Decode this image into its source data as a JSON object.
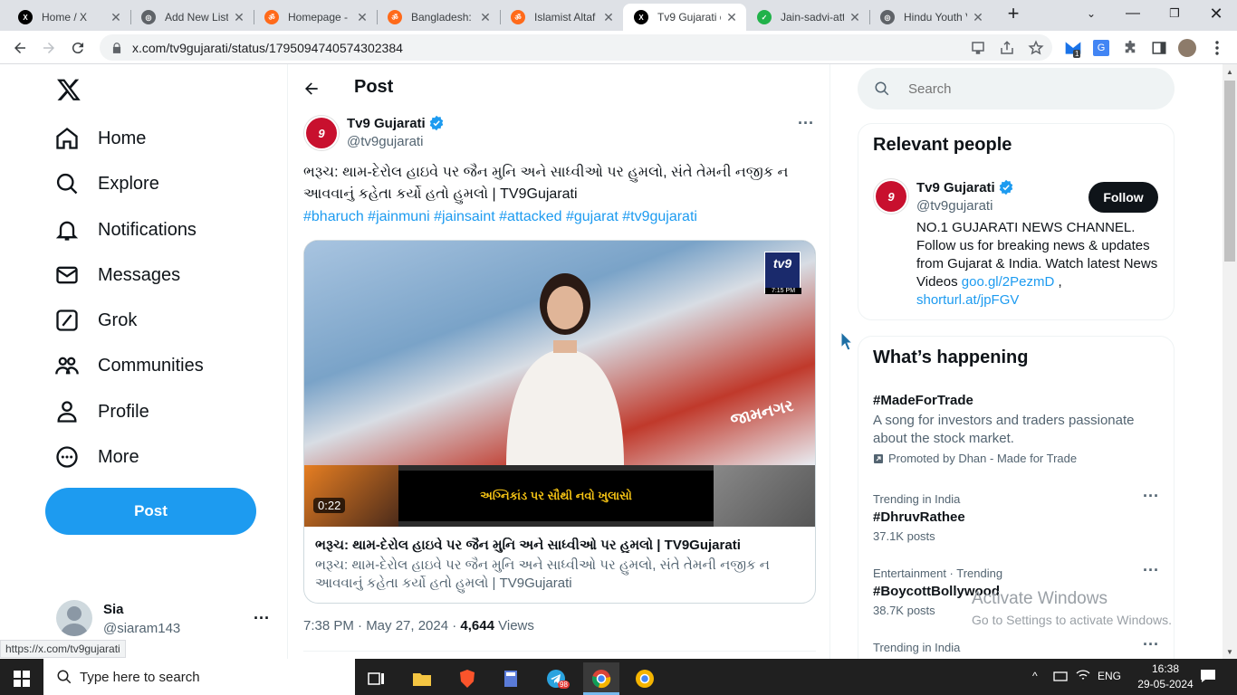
{
  "browser": {
    "tabs": [
      {
        "title": "Home / X",
        "icon": "x-logo-icon",
        "color": "#000000"
      },
      {
        "title": "Add New List",
        "icon": "globe-icon",
        "color": "#5f6368"
      },
      {
        "title": "Homepage - ",
        "icon": "hindutva-icon",
        "color": "#ff6a1a"
      },
      {
        "title": "Bangladesh: I",
        "icon": "hindutva-icon",
        "color": "#ff6a1a"
      },
      {
        "title": "Islamist Altaf",
        "icon": "hindutva-icon",
        "color": "#ff6a1a"
      },
      {
        "title": "Tv9 Gujarati o",
        "icon": "x-logo-icon",
        "color": "#000000"
      },
      {
        "title": "Jain-sadvi-att",
        "icon": "leaf-icon",
        "color": "#21b24a"
      },
      {
        "title": "Hindu Youth V",
        "icon": "globe-icon",
        "color": "#5f6368"
      }
    ],
    "url": "x.com/tv9gujarati/status/1795094740574302384",
    "status_url": "https://x.com/tv9gujarati",
    "ext_badge": "1"
  },
  "sidebar": {
    "items": [
      {
        "label": "Home",
        "icon": "home-icon"
      },
      {
        "label": "Explore",
        "icon": "search-icon"
      },
      {
        "label": "Notifications",
        "icon": "bell-icon"
      },
      {
        "label": "Messages",
        "icon": "mail-icon"
      },
      {
        "label": "Grok",
        "icon": "grok-icon"
      },
      {
        "label": "Communities",
        "icon": "people-icon"
      },
      {
        "label": "Profile",
        "icon": "person-icon"
      },
      {
        "label": "More",
        "icon": "more-circle-icon"
      }
    ],
    "post_label": "Post",
    "account": {
      "name": "Sia",
      "handle": "@siaram143"
    }
  },
  "post": {
    "header": "Post",
    "author_name": "Tv9 Gujarati",
    "author_handle": "@tv9gujarati",
    "text": "ભરૂચ: થામ-દેરોલ હાઇવે પર જૈન મુનિ અને સાધ્વીઓ પર હુમલો, સંતે તેમની નજીક ન આવવાનું કહેતા કર્યો હતો હુમલો | TV9Gujarati",
    "hashtags": "#bharuch #jainmuni #jainsaint #attacked #gujarat #tv9gujarati",
    "video_duration": "0:22",
    "video_banner": "અગ્નિકાંડ પર સૌથી નવો ખુલાસો",
    "video_logo": "tv9",
    "video_time": "7:15 PM",
    "video_city": "જામનગર",
    "card_title": "ભરૂચ: થામ-દેરોલ હાઇવે પર જૈન મુનિ અને સાધ્વીઓ પર હુમલો | TV9Gujarati",
    "card_desc": "ભરૂચ: થામ-દેરોલ હાઇવે પર જૈન મુનિ અને સાધ્વીઓ પર હુમલો, સંતે તેમની નજીક ન આવવાનું કહેતા કર્યો હતો હુમલો | TV9Gujarati",
    "timestamp": "7:38 PM · May 27, 2024 · ",
    "views_count": "4,644",
    "views_label": " Views"
  },
  "search": {
    "placeholder": "Search"
  },
  "relevant": {
    "title": "Relevant people",
    "name": "Tv9 Gujarati",
    "handle": "@tv9gujarati",
    "follow": "Follow",
    "bio": "NO.1 GUJARATI NEWS CHANNEL. Follow us for breaking news & updates from Gujarat & India. Watch latest News Videos ",
    "link1": "goo.gl/2PezmD",
    "link_sep": " ,",
    "link2": "shorturl.at/jpFGV"
  },
  "happening": {
    "title": "What’s happening",
    "promo_tag": "#MadeForTrade",
    "promo_desc": "A song for investors and traders passionate about the stock market.",
    "promo_by": "Promoted by Dhan - Made for Trade",
    "trends": [
      {
        "context": "Trending in India",
        "tag": "#DhruvRathee",
        "posts": "37.1K posts"
      },
      {
        "context": "Entertainment · Trending",
        "tag": "#BoycottBollywood",
        "posts": "38.7K posts"
      },
      {
        "context": "Trending in India",
        "tag": "",
        "posts": ""
      }
    ]
  },
  "watermark": {
    "line1": "Activate Windows",
    "line2": "Go to Settings to activate Windows."
  },
  "taskbar": {
    "search_placeholder": "Type here to search",
    "lang": "ENG",
    "time": "16:38",
    "date": "29-05-2024",
    "telegram_badge": "98"
  }
}
